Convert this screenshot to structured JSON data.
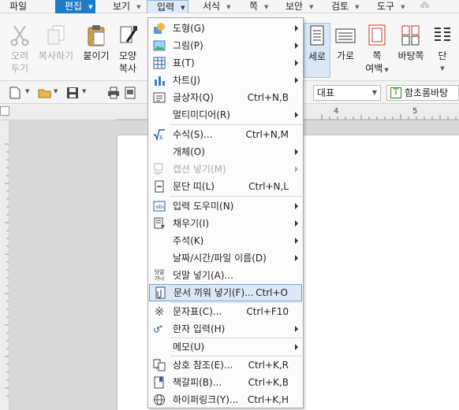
{
  "menubar": {
    "file": "파일",
    "edit": "편집",
    "view": "보기",
    "insert": "입력",
    "format": "서식",
    "page": "쪽",
    "security": "보안",
    "review": "검토",
    "tools": "도구"
  },
  "ribbon": {
    "cut": [
      "오려",
      "두기"
    ],
    "copy": "복사하기",
    "paste": "붙이기",
    "shape": [
      "모양",
      "복사"
    ],
    "vertical": "세로",
    "horizontal": "가로",
    "margins": [
      "쪽",
      "여백"
    ],
    "page_border": "바탕쪽",
    "columns": "단"
  },
  "format_bar": {
    "style": "대표",
    "font": "함초롬바탕"
  },
  "insert_menu": {
    "items": [
      {
        "label": "도형(G)",
        "shortcut": "",
        "submenu": true,
        "icon": "shape-icon"
      },
      {
        "label": "그림(P)",
        "shortcut": "",
        "submenu": true,
        "icon": "picture-icon"
      },
      {
        "label": "표(T)",
        "shortcut": "",
        "submenu": true,
        "icon": "table-icon"
      },
      {
        "label": "차트(J)",
        "shortcut": "",
        "submenu": true,
        "icon": "chart-icon"
      },
      {
        "label": "글상자(Q)",
        "shortcut": "Ctrl+N,B",
        "submenu": false,
        "icon": "textbox-icon"
      },
      {
        "label": "멀티미디어(R)",
        "shortcut": "",
        "submenu": true,
        "icon": ""
      },
      {
        "label": "수식(S)...",
        "shortcut": "Ctrl+N,M",
        "submenu": false,
        "icon": "formula-icon"
      },
      {
        "label": "개체(O)",
        "shortcut": "",
        "submenu": true,
        "icon": ""
      },
      {
        "label": "캡션 넣기(M)",
        "shortcut": "",
        "submenu": true,
        "icon": "caption-icon",
        "disabled": true
      },
      {
        "label": "문단 띠(L)",
        "shortcut": "Ctrl+N,L",
        "submenu": false,
        "icon": "paragraph-band-icon"
      },
      {
        "label": "입력 도우미(N)",
        "shortcut": "",
        "submenu": true,
        "icon": "input-helper-icon"
      },
      {
        "label": "채우기(I)",
        "shortcut": "",
        "submenu": true,
        "icon": "fill-icon"
      },
      {
        "label": "주석(K)",
        "shortcut": "",
        "submenu": true,
        "icon": ""
      },
      {
        "label": "날짜/시간/파일 이름(D)",
        "shortcut": "",
        "submenu": true,
        "icon": ""
      },
      {
        "label": "덧말 넣기(A)...",
        "shortcut": "",
        "submenu": false,
        "icon": "ruby-text-icon"
      },
      {
        "label": "문서 끼워 넣기(F)...",
        "shortcut": "Ctrl+O",
        "submenu": false,
        "icon": "insert-document-icon",
        "highlighted": true
      },
      {
        "label": "문자표(C)...",
        "shortcut": "Ctrl+F10",
        "submenu": false,
        "icon": "symbol-icon"
      },
      {
        "label": "한자 입력(H)",
        "shortcut": "",
        "submenu": true,
        "icon": "hanja-icon"
      },
      {
        "label": "메모(U)",
        "shortcut": "",
        "submenu": true,
        "icon": ""
      },
      {
        "label": "상호 참조(E)...",
        "shortcut": "Ctrl+K,R",
        "submenu": false,
        "icon": "cross-reference-icon"
      },
      {
        "label": "책갈피(B)...",
        "shortcut": "Ctrl+K,B",
        "submenu": false,
        "icon": "bookmark-icon"
      },
      {
        "label": "하이퍼링크(Y)...",
        "shortcut": "Ctrl+K,H",
        "submenu": false,
        "icon": "hyperlink-icon"
      }
    ]
  },
  "ruler_numbers": [
    "4",
    "5"
  ],
  "colors": {
    "accent": "#1e7bc6",
    "highlight": "#dbe8f7",
    "highlight_border": "#6d9fd5"
  }
}
